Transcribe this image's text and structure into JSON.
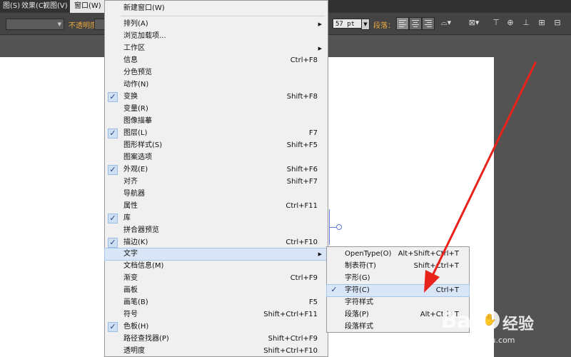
{
  "menubar": {
    "items": [
      {
        "label": "图(S)"
      },
      {
        "label": "效果(C)"
      },
      {
        "label": "视图(V)"
      },
      {
        "label": "窗口(W)"
      }
    ]
  },
  "controlbar": {
    "opacity_label": "不透明度：",
    "font_size": "57 pt",
    "paragraph_label": "段落："
  },
  "window_menu": {
    "items": [
      {
        "label": "新建窗口(W)",
        "shortcut": "",
        "checked": false,
        "submenu": false
      },
      {
        "label": "排列(A)",
        "shortcut": "",
        "checked": false,
        "submenu": true
      },
      {
        "label": "浏览加载项...",
        "shortcut": "",
        "checked": false,
        "submenu": false
      },
      {
        "label": "工作区",
        "shortcut": "",
        "checked": false,
        "submenu": true
      },
      {
        "label": "信息",
        "shortcut": "Ctrl+F8",
        "checked": false,
        "submenu": false
      },
      {
        "label": "分色预览",
        "shortcut": "",
        "checked": false,
        "submenu": false
      },
      {
        "label": "动作(N)",
        "shortcut": "",
        "checked": false,
        "submenu": false
      },
      {
        "label": "变换",
        "shortcut": "Shift+F8",
        "checked": true,
        "submenu": false
      },
      {
        "label": "变量(R)",
        "shortcut": "",
        "checked": false,
        "submenu": false
      },
      {
        "label": "图像描摹",
        "shortcut": "",
        "checked": false,
        "submenu": false
      },
      {
        "label": "图层(L)",
        "shortcut": "F7",
        "checked": true,
        "submenu": false
      },
      {
        "label": "图形样式(S)",
        "shortcut": "Shift+F5",
        "checked": false,
        "submenu": false
      },
      {
        "label": "图案选项",
        "shortcut": "",
        "checked": false,
        "submenu": false
      },
      {
        "label": "外观(E)",
        "shortcut": "Shift+F6",
        "checked": true,
        "submenu": false
      },
      {
        "label": "对齐",
        "shortcut": "Shift+F7",
        "checked": false,
        "submenu": false
      },
      {
        "label": "导航器",
        "shortcut": "",
        "checked": false,
        "submenu": false
      },
      {
        "label": "属性",
        "shortcut": "Ctrl+F11",
        "checked": false,
        "submenu": false
      },
      {
        "label": "库",
        "shortcut": "",
        "checked": true,
        "submenu": false
      },
      {
        "label": "拼合器预览",
        "shortcut": "",
        "checked": false,
        "submenu": false
      },
      {
        "label": "描边(K)",
        "shortcut": "Ctrl+F10",
        "checked": true,
        "submenu": false
      },
      {
        "label": "文字",
        "shortcut": "",
        "checked": false,
        "submenu": true,
        "highlight": true
      },
      {
        "label": "文档信息(M)",
        "shortcut": "",
        "checked": false,
        "submenu": false
      },
      {
        "label": "渐变",
        "shortcut": "Ctrl+F9",
        "checked": false,
        "submenu": false
      },
      {
        "label": "画板",
        "shortcut": "",
        "checked": false,
        "submenu": false
      },
      {
        "label": "画笔(B)",
        "shortcut": "F5",
        "checked": false,
        "submenu": false
      },
      {
        "label": "符号",
        "shortcut": "Shift+Ctrl+F11",
        "checked": false,
        "submenu": false
      },
      {
        "label": "色板(H)",
        "shortcut": "",
        "checked": true,
        "submenu": false
      },
      {
        "label": "路径查找器(P)",
        "shortcut": "Shift+Ctrl+F9",
        "checked": false,
        "submenu": false
      },
      {
        "label": "透明度",
        "shortcut": "Shift+Ctrl+F10",
        "checked": false,
        "submenu": false
      }
    ]
  },
  "text_submenu": {
    "items": [
      {
        "label": "OpenType(O)",
        "shortcut": "Alt+Shift+Ctrl+T",
        "checked": false
      },
      {
        "label": "制表符(T)",
        "shortcut": "Shift+Ctrl+T",
        "checked": false
      },
      {
        "label": "字形(G)",
        "shortcut": "",
        "checked": false
      },
      {
        "label": "字符(C)",
        "shortcut": "Ctrl+T",
        "checked": true,
        "highlight": true
      },
      {
        "label": "字符样式",
        "shortcut": "",
        "checked": false
      },
      {
        "label": "段落(P)",
        "shortcut": "Alt+Ctrl+T",
        "checked": false
      },
      {
        "label": "段落样式",
        "shortcut": "",
        "checked": false
      }
    ]
  },
  "watermark": {
    "brand": "Bai",
    "title": "经验",
    "url": "jingyan.baidu.com"
  },
  "icons": {
    "check": "checkmark-icon",
    "submenu": "submenu-arrow-icon",
    "annotation": "red-arrow-icon"
  }
}
